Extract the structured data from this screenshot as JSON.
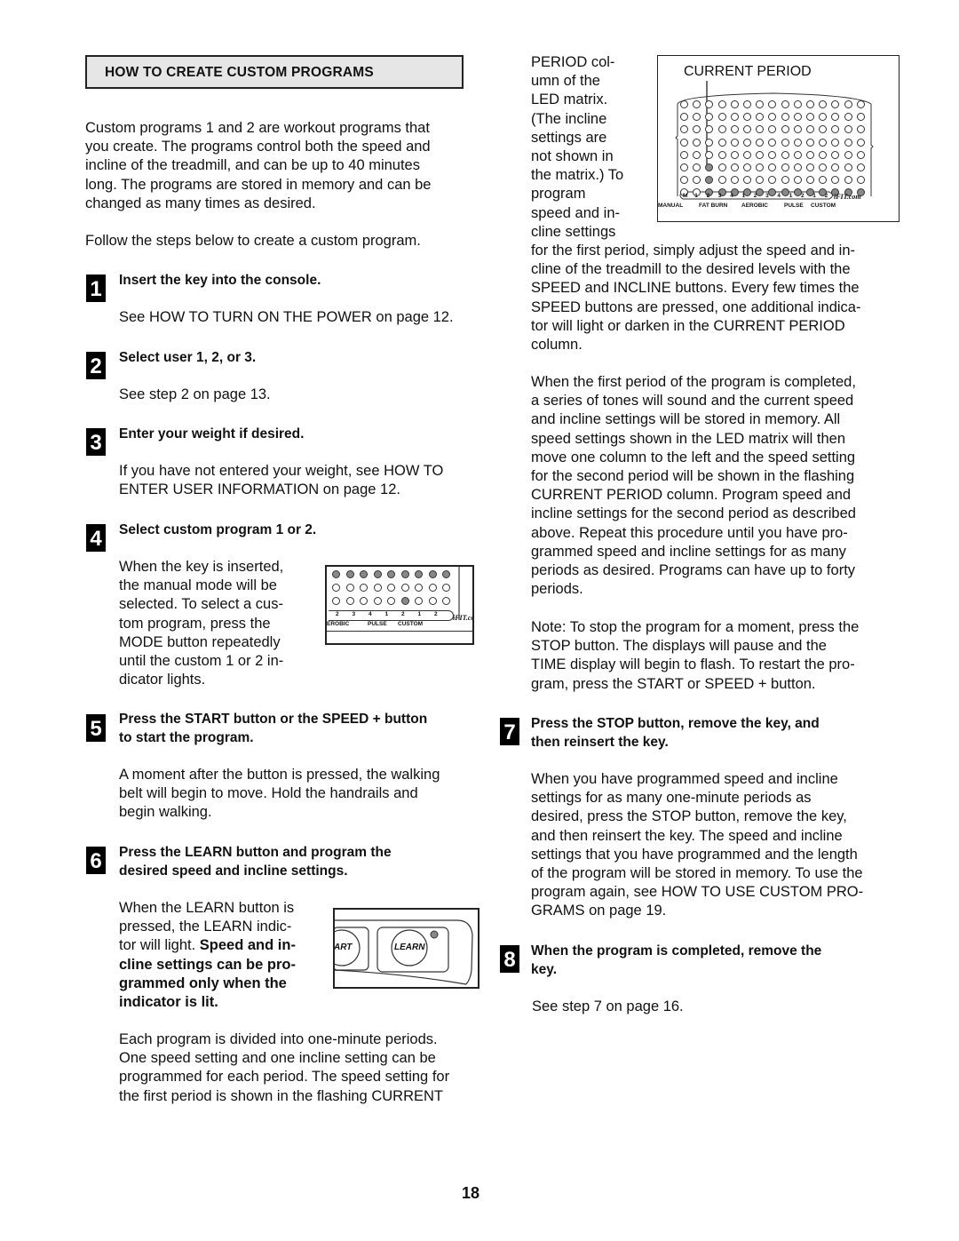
{
  "section": {
    "title": "HOW TO CREATE CUSTOM PROGRAMS",
    "intro": [
      "Custom programs 1 and 2 are workout programs that",
      "you create. The programs control both the speed and",
      "incline of the treadmill, and can be up to 40 minutes",
      "long. The programs are stored in memory and can be",
      "changed as many times as desired."
    ],
    "follow": "Follow the steps below to create a custom program."
  },
  "steps": [
    {
      "number": "1",
      "heading": [
        "Insert the key into the console."
      ],
      "body": [
        "See HOW TO TURN ON THE POWER on page 12."
      ]
    },
    {
      "number": "2",
      "heading": [
        "Select user 1, 2, or 3."
      ],
      "body": [
        "See step 2 on page 13."
      ]
    },
    {
      "number": "3",
      "heading": [
        "Enter your weight if desired."
      ],
      "body": [
        "If you have not entered your weight, see HOW TO",
        "ENTER USER INFORMATION on page 12."
      ]
    },
    {
      "number": "4",
      "heading": [
        "Select custom program 1 or 2."
      ],
      "body": [
        "When the key is inserted,",
        "the manual mode will be",
        "selected. To select a cus-",
        "tom program, press the",
        "MODE button repeatedly",
        "until the custom 1 or 2 in-",
        "dicator lights."
      ]
    },
    {
      "number": "5",
      "heading": [
        "Press the START button or the SPEED + button",
        "to start the program."
      ],
      "body": [
        "A moment after the button is pressed, the walking",
        "belt will begin to move. Hold the handrails and",
        "begin walking."
      ]
    },
    {
      "number": "6",
      "heading": [
        "Press the LEARN button and program the",
        "desired speed and incline settings."
      ],
      "body": [
        "When the LEARN button is",
        "pressed, the LEARN indic-"
      ],
      "body_mixed": {
        "normal": "tor will light. ",
        "bold": "Speed and in-"
      },
      "body_bold": [
        "cline settings can be pro-",
        "grammed only when the",
        "indicator is lit."
      ],
      "body2": [
        "Each program is divided into one-minute periods.",
        "One speed setting and one incline setting can be",
        "programmed for each period. The speed setting for",
        "the first period is shown in the flashing CURRENT"
      ],
      "body3": [
        "PERIOD col-",
        "umn of the",
        "LED matrix.",
        "(The incline",
        "settings are",
        "not shown in",
        "the matrix.) To",
        "program",
        "speed and in-",
        "cline settings"
      ],
      "body4": [
        "for the first period, simply adjust the speed and in-",
        "cline of the treadmill to the desired levels with the",
        "SPEED and INCLINE buttons. Every few times the",
        "SPEED buttons are pressed, one additional indica-",
        "tor will light or darken in the CURRENT PERIOD",
        "column."
      ],
      "body5": [
        "When the first period of the program is completed,",
        "a series of tones will sound and the current speed",
        "and incline settings will be stored in memory. All",
        "speed settings shown in the LED matrix will then",
        "move one column to the left and the speed setting",
        "for the second period will be shown in the flashing",
        "CURRENT PERIOD column. Program speed and",
        "incline settings for the second period as described",
        "above. Repeat this procedure until you have pro-",
        "grammed speed and incline settings for as many",
        "periods as desired. Programs can have up to forty",
        "periods."
      ],
      "note": [
        "Note: To stop the program for a moment, press the",
        "STOP button. The displays will pause and the",
        "TIME display will begin to flash. To restart the pro-",
        "gram, press the START or SPEED + button."
      ]
    },
    {
      "number": "7",
      "heading": [
        "Press the STOP button, remove the key, and",
        "then reinsert the key."
      ],
      "body": [
        "When you have programmed speed and incline",
        "settings for as many one-minute periods as",
        "desired, press the STOP button, remove the key,",
        "and then reinsert the key. The speed and incline",
        "settings that you have programmed and the length",
        "of the program will be stored in memory. To use the",
        "program again, see HOW TO USE CUSTOM PRO-",
        "GRAMS on page 19."
      ]
    },
    {
      "number": "8",
      "heading": [
        "When the program is completed, remove the",
        "key."
      ],
      "body": [
        "See step 7 on page 16."
      ]
    }
  ],
  "figures": {
    "current_period": {
      "label": "CURRENT PERIOD",
      "rows": 8,
      "cols": 15,
      "current_column": 3,
      "lit_levels": [
        1,
        1,
        3,
        1,
        1,
        1,
        1,
        1,
        1,
        1,
        1,
        1,
        1,
        1,
        1
      ],
      "program_numbers": [
        "M",
        "1",
        "2",
        "3",
        "4",
        "1",
        "2",
        "3",
        "4",
        "1",
        "2",
        "1",
        "2"
      ],
      "program_groups": [
        "MANUAL",
        "FAT BURN",
        "AEROBIC",
        "PULSE",
        "CUSTOM"
      ],
      "brand": "iFIT.com"
    },
    "mode_display": {
      "program_numbers": [
        "2",
        "3",
        "4",
        "1",
        "2",
        "1",
        "2"
      ],
      "program_groups": [
        "EROBIC",
        "PULSE",
        "CUSTOM"
      ],
      "brand": "iFIT.com",
      "lit_custom_index": 6
    },
    "learn_button": {
      "left_label": "ART",
      "label": "LEARN"
    }
  },
  "page_number": "18"
}
